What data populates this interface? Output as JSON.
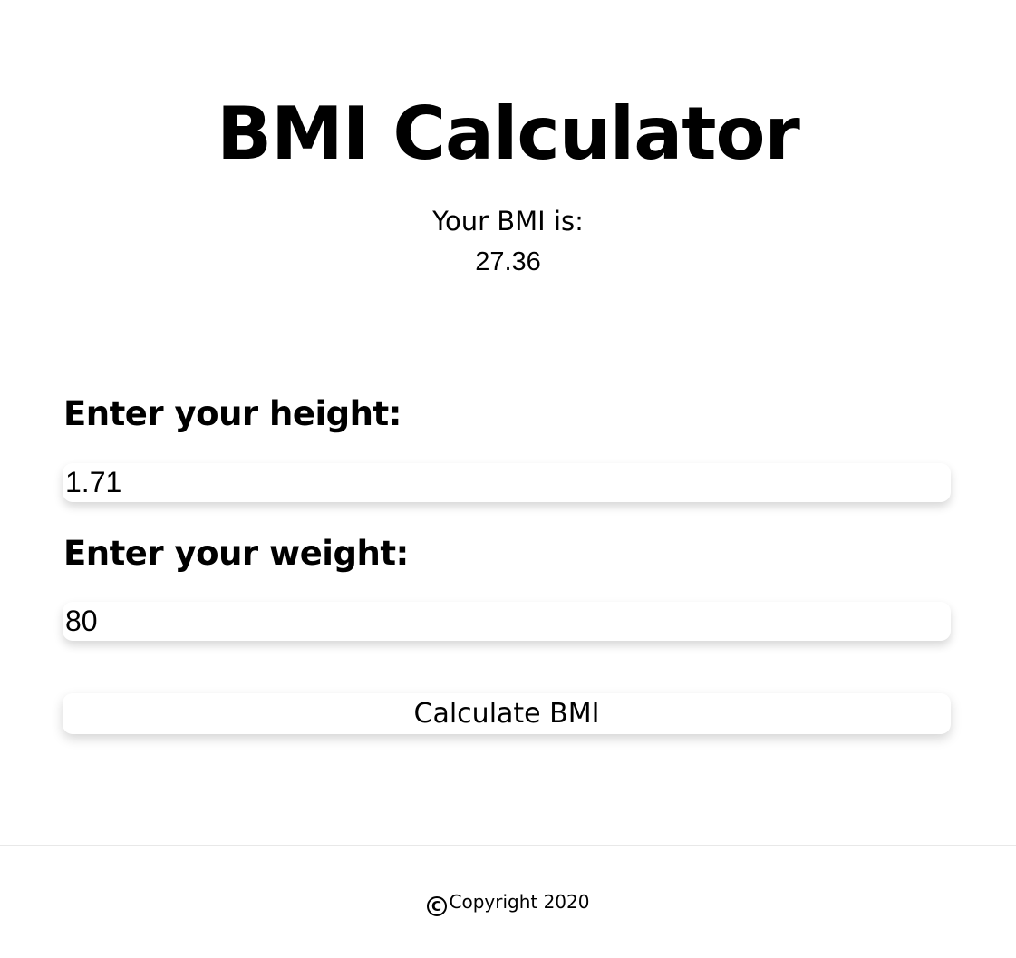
{
  "header": {
    "title": "BMI Calculator"
  },
  "result": {
    "label": "Your BMI is:",
    "value": "27.36"
  },
  "form": {
    "height_label": "Enter your height:",
    "height_value": "1.71",
    "weight_label": "Enter your weight:",
    "weight_value": "80",
    "submit_label": "Calculate BMI"
  },
  "footer": {
    "copyright_symbol": "C",
    "copyright_text": "Copyright 2020"
  },
  "icons": {
    "copyright": "copyright-icon"
  }
}
